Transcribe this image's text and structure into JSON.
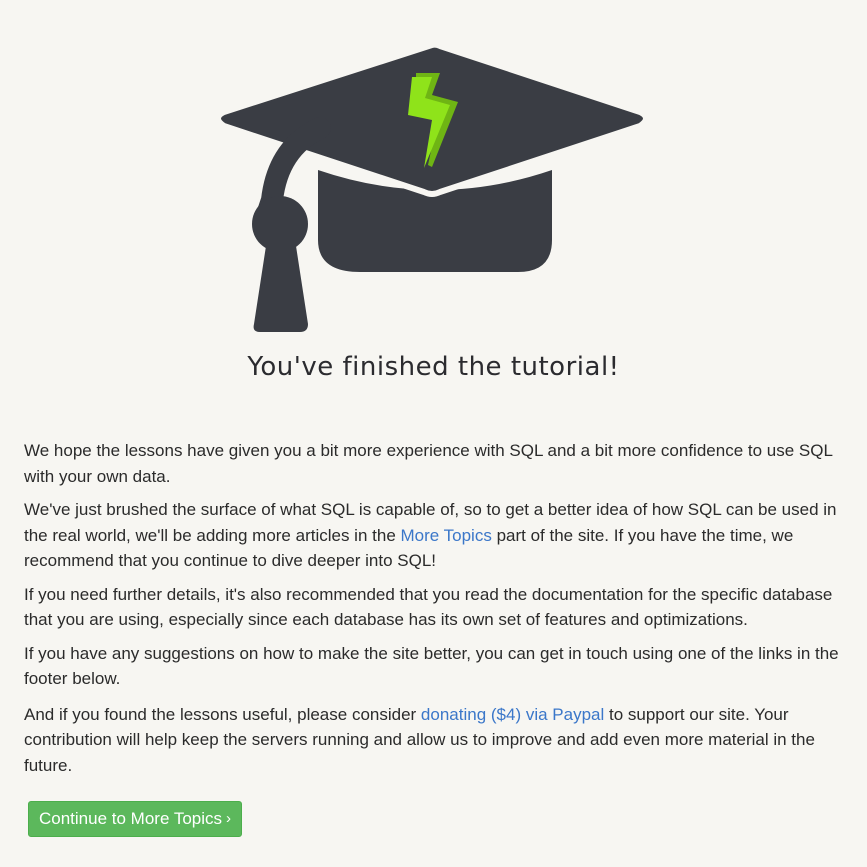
{
  "page": {
    "title": "You've finished the tutorial!"
  },
  "hero": {
    "icon": "graduation-cap-lightning-icon",
    "colors": {
      "cap": "#3a3d44",
      "bolt": "#8fe31a",
      "bolt_shadow": "#6fb514"
    }
  },
  "content": {
    "p1": "We hope the lessons have given you a bit more experience with SQL and a bit more confidence to use SQL with your own data.",
    "p2_before": "We've just brushed the surface of what SQL is capable of, so to get a better idea of how SQL can be used in the real world, we'll be adding more articles in the ",
    "p2_link": "More Topics",
    "p2_after": " part of the site. If you have the time, we recommend that you continue to dive deeper into SQL!",
    "p3": "If you need further details, it's also recommended that you read the documentation for the specific database that you are using, especially since each database has its own set of features and optimizations.",
    "p4": "If you have any suggestions on how to make the site better, you can get in touch using one of the links in the footer below.",
    "p5_before": "And if you found the lessons useful, please consider ",
    "p5_link": "donating ($4) via Paypal",
    "p5_after": " to support our site. Your contribution will help keep the servers running and allow us to improve and add even more material in the future."
  },
  "cta": {
    "label": "Continue to More Topics",
    "chevron": "›",
    "color": "#5cb85c"
  },
  "colors": {
    "background": "#f7f6f2",
    "link": "#3b77c9",
    "text": "#2b2b2b"
  }
}
